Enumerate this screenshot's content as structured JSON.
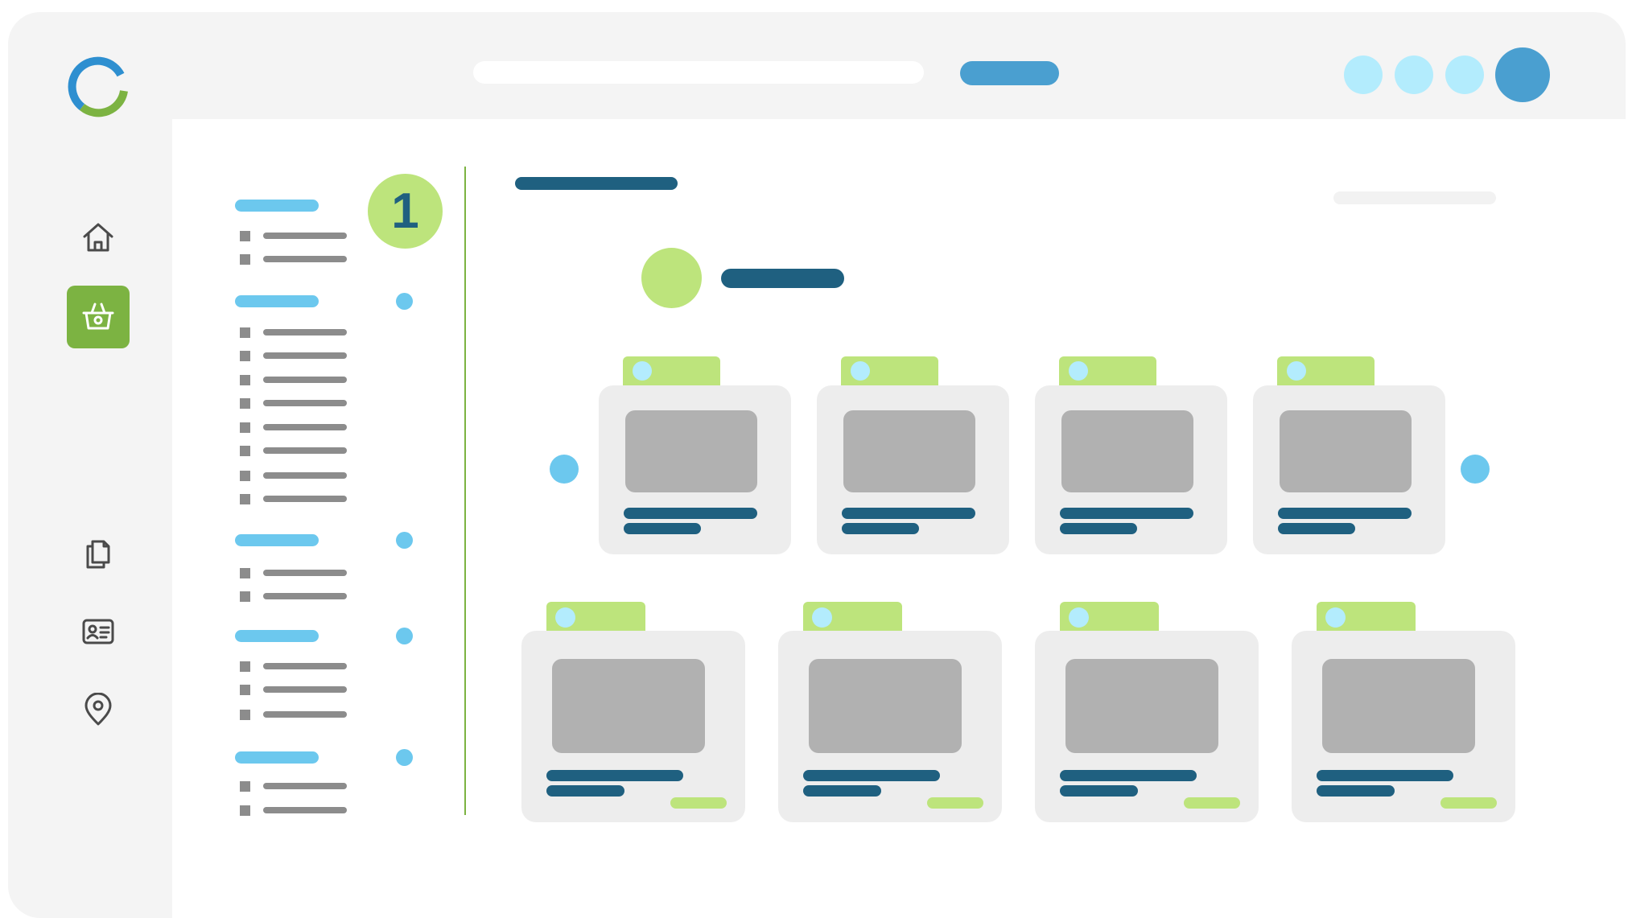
{
  "colors": {
    "frame": "#f4f4f4",
    "content": "#ffffff",
    "navy": "#1f6080",
    "sky": "#6cc8ee",
    "pale_sky": "#b3ecfd",
    "brand_blue": "#4a9fd0",
    "lime": "#bde47c",
    "green_active": "#7cb342",
    "gray_line": "#8c8c8c",
    "card": "#ededed",
    "thumb": "#b1b1b1"
  },
  "header": {
    "logo_icon": "app-logo-icon",
    "search_bar_icon": "search-bar-placeholder",
    "action_button_icon": "primary-action-pill",
    "avatars": [
      "avatar-circle",
      "avatar-circle",
      "avatar-circle",
      "profile-avatar"
    ]
  },
  "sidebar": {
    "items": [
      {
        "icon": "home-icon",
        "active": false
      },
      {
        "icon": "basket-icon",
        "active": true
      },
      {
        "icon": "documents-icon",
        "active": false
      },
      {
        "icon": "id-card-icon",
        "active": false
      },
      {
        "icon": "location-pin-icon",
        "active": false
      }
    ]
  },
  "filters": {
    "step_number": "1",
    "groups": [
      {
        "options": 2,
        "has_indicator": false
      },
      {
        "options": 8,
        "has_indicator": true
      },
      {
        "options": 2,
        "has_indicator": true
      },
      {
        "options": 3,
        "has_indicator": true
      },
      {
        "options": 2,
        "has_indicator": true
      }
    ]
  },
  "main": {
    "carousel": {
      "cards": 4,
      "has_prev_arrow": true,
      "has_next_arrow": true
    },
    "grid": {
      "cards": 4
    }
  }
}
